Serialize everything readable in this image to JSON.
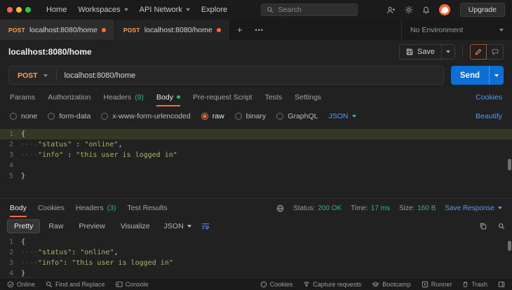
{
  "topbar": {
    "menu": [
      "Home",
      "Workspaces",
      "API Network",
      "Explore"
    ],
    "search_placeholder": "Search",
    "upgrade_label": "Upgrade"
  },
  "tabstrip": {
    "tabs": [
      {
        "method": "POST",
        "title": "localhost:8080/home"
      },
      {
        "method": "POST",
        "title": "localhost:8080/home"
      }
    ],
    "add_label": "+",
    "more_label": "•••",
    "environment": "No Environment"
  },
  "request": {
    "title": "localhost:8080/home",
    "save_label": "Save",
    "method": "POST",
    "url": "localhost:8080/home",
    "send_label": "Send",
    "tabs": [
      {
        "label": "Params"
      },
      {
        "label": "Authorization"
      },
      {
        "label": "Headers",
        "count": "(9)"
      },
      {
        "label": "Body"
      },
      {
        "label": "Pre-request Script"
      },
      {
        "label": "Tests"
      },
      {
        "label": "Settings"
      }
    ],
    "cookies_link": "Cookies",
    "modes": [
      "none",
      "form-data",
      "x-www-form-urlencoded",
      "raw",
      "binary",
      "GraphQL"
    ],
    "selected_mode": "raw",
    "language": "JSON",
    "beautify_link": "Beautify"
  },
  "request_editor": {
    "line_numbers": [
      "1",
      "2",
      "3",
      "4",
      "5"
    ],
    "l1": "{",
    "indent": "····",
    "l2_key": "\"status\"",
    "l2_sep": " : ",
    "l2_val": "\"online\"",
    "l2_comma": ",",
    "l3_key": "\"info\"",
    "l3_sep": " : ",
    "l3_val": "\"this user is logged in\"",
    "l5": "}"
  },
  "response": {
    "tabs": [
      {
        "label": "Body"
      },
      {
        "label": "Cookies"
      },
      {
        "label": "Headers",
        "count": "(3)"
      },
      {
        "label": "Test Results"
      }
    ],
    "status_label": "Status:",
    "status_value": "200 OK",
    "time_label": "Time:",
    "time_value": "17 ms",
    "size_label": "Size:",
    "size_value": "160 B",
    "save_response_label": "Save Response",
    "views": [
      "Pretty",
      "Raw",
      "Preview",
      "Visualize"
    ],
    "language": "JSON"
  },
  "response_editor": {
    "line_numbers": [
      "1",
      "2",
      "3",
      "4"
    ],
    "l1": "{",
    "indent": "····",
    "l2_key": "\"status\"",
    "l2_sep": ": ",
    "l2_val": "\"online\"",
    "l2_comma": ",",
    "l3_key": "\"info\"",
    "l3_sep": ": ",
    "l3_val": "\"this user is logged in\"",
    "l4": "}"
  },
  "statusbar": {
    "online": "Online",
    "find": "Find and Replace",
    "console": "Console",
    "cookies": "Cookies",
    "capture": "Capture requests",
    "bootcamp": "Bootcamp",
    "runner": "Runner",
    "trash": "Trash"
  },
  "colors": {
    "accent_orange": "#ff6c37",
    "method_post": "#ffa24e",
    "send_blue": "#0b6fd6",
    "link_blue": "#539bf5",
    "success_green": "#29b876"
  }
}
